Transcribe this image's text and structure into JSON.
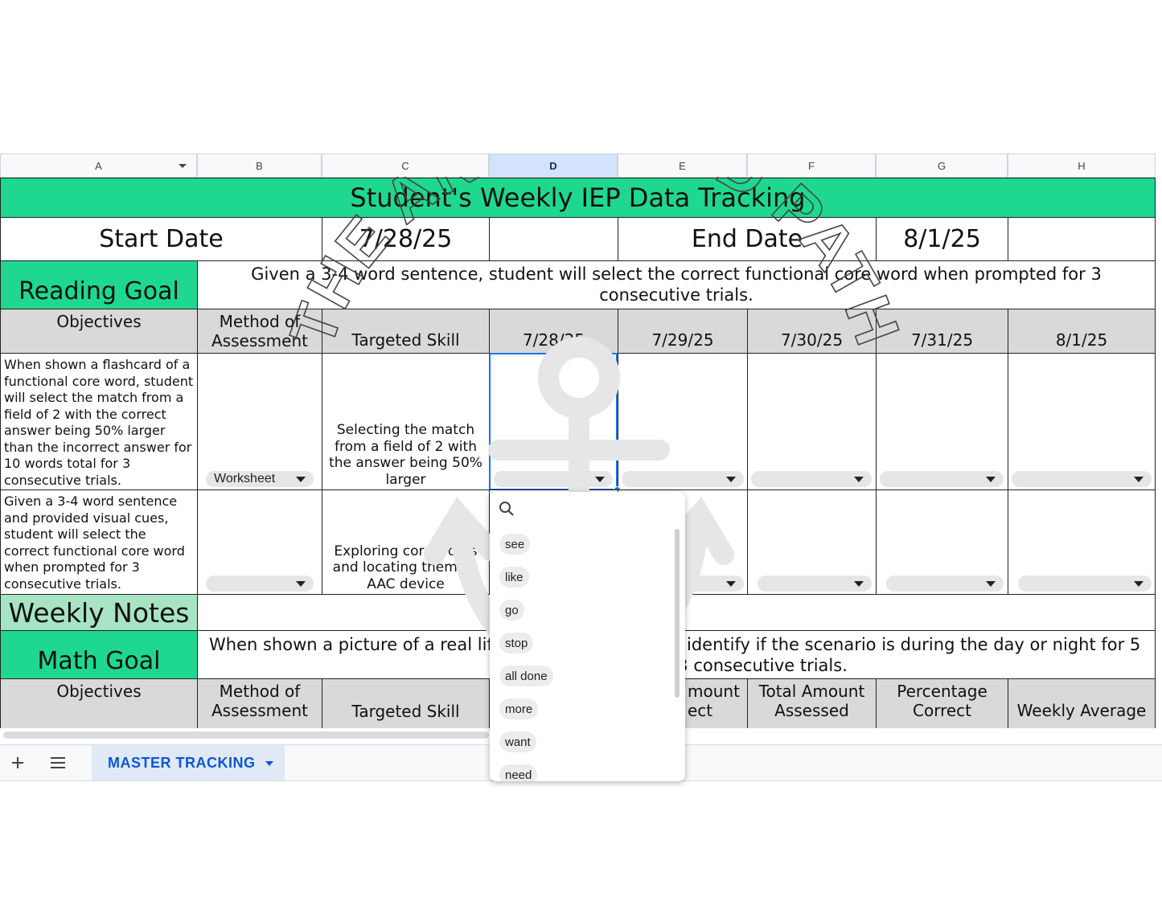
{
  "columns": [
    "A",
    "B",
    "C",
    "D",
    "E",
    "F",
    "G",
    "H"
  ],
  "title": "Student's Weekly IEP Data Tracking",
  "dates": {
    "start_label": "Start Date",
    "start_value": "7/28/25",
    "end_label": "End Date",
    "end_value": "8/1/25"
  },
  "reading": {
    "label": "Reading Goal",
    "goal_text": "Given a 3-4 word sentence, student will select the correct functional core word when prompted for 3 consecutive trials.",
    "headers": [
      "Objectives",
      "Method of Assessment",
      "Targeted Skill",
      "7/28/25",
      "7/29/25",
      "7/30/25",
      "7/31/25",
      "8/1/25"
    ],
    "rows": [
      {
        "objective": "When shown a flashcard of a functional core word, student will select the match from a field of 2 with the correct answer being 50% larger than the incorrect answer for 10 words total for 3 consecutive trials.",
        "method": "Worksheet",
        "skill": "Selecting the match from a field of 2 with the answer being 50% larger"
      },
      {
        "objective": "Given a 3-4 word sentence and provided visual cues, student will select the correct functional core word when prompted for 3 consecutive trials.",
        "method": "",
        "skill": "Exploring core words and locating them on AAC device"
      }
    ]
  },
  "weekly_notes_label": "Weekly Notes",
  "math": {
    "label": "Math Goal",
    "goal_text_left": "When shown a picture of a real lif",
    "goal_text_right_line1": "identify if the scenario is during the day or night for 5",
    "goal_text_right_line2": "r 3 consecutive trials.",
    "headers": {
      "objectives": "Objectives",
      "method": "Method of Assessment",
      "skill": "Targeted Skill",
      "amount_partial_1": "mount",
      "amount_partial_2": "ect",
      "total": "Total Amount Assessed",
      "percentage": "Percentage Correct",
      "weekly": "Weekly Average"
    }
  },
  "dropdown": {
    "search_icon": "search-icon",
    "options": [
      "see",
      "like",
      "go",
      "stop",
      "all done",
      "more",
      "want",
      "need"
    ]
  },
  "sheet_tabs": {
    "add_icon": "plus-icon",
    "menu_icon": "list-icon",
    "active_tab": "MASTER TRACKING"
  },
  "watermark": "THE ANCHORED PATH",
  "colors": {
    "header_green": "#1fd88f",
    "notes_green": "#a8e4c3",
    "header_gray": "#d9d9d9",
    "selection_blue": "#1a73e8",
    "tab_blue": "#0b57d0"
  }
}
